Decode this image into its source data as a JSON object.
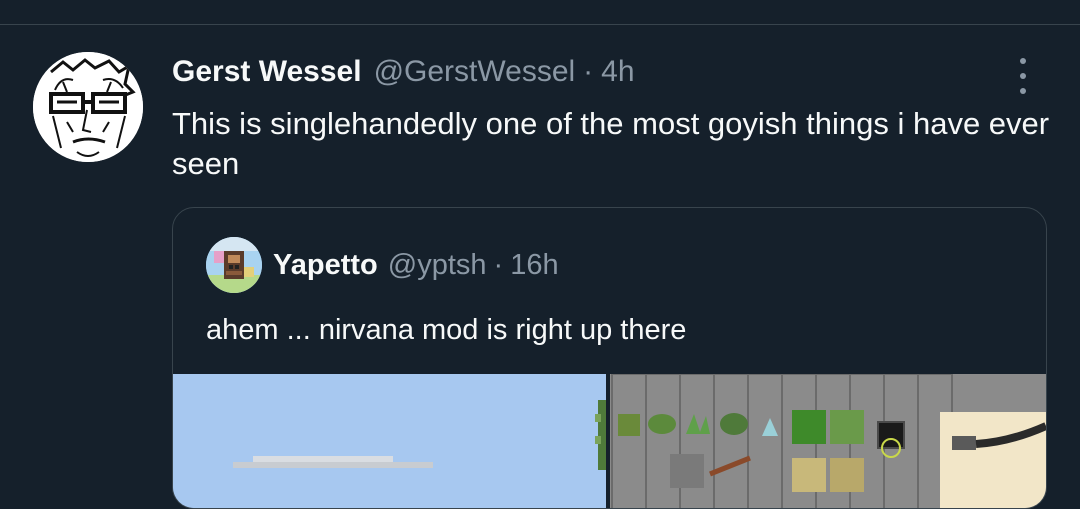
{
  "tweet": {
    "author_name": "Gerst Wessel",
    "author_handle": "@GerstWessel",
    "separator": "·",
    "time": "4h",
    "text": "This is singlehandedly one of the most goyish things i have ever seen"
  },
  "quoted_tweet": {
    "author_name": "Yapetto",
    "author_handle": "@yptsh",
    "separator": "·",
    "time": "16h",
    "text": "ahem ... nirvana mod is right up there"
  },
  "colors": {
    "background": "#15202b",
    "text": "#f7f9f9",
    "secondary_text": "#8b98a5",
    "border": "#38444d"
  },
  "icons": {
    "more": "more-vertical-icon",
    "peace": "peace-icon",
    "pipe": "pipe-icon"
  }
}
